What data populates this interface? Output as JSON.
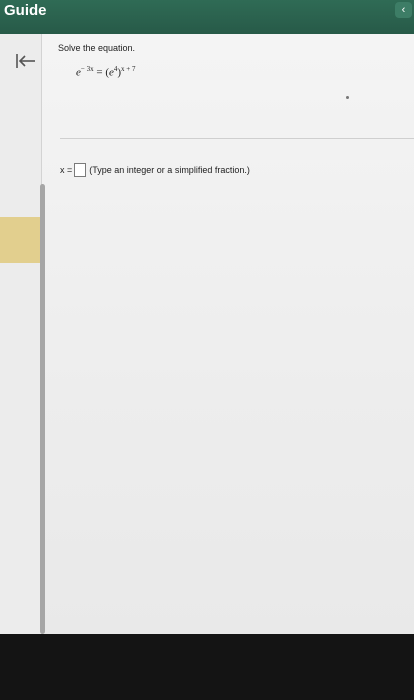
{
  "header": {
    "title": "Guide",
    "collapse_glyph": "‹",
    "collapse_icon": "chevron-left-icon",
    "background_color": "#2f6b55"
  },
  "sidebar": {
    "back_icon": "collapse-left-arrow-icon",
    "highlight_color": "#e2cf8e"
  },
  "problem": {
    "instruction": "Solve the equation.",
    "equation": {
      "lhs_base": "e",
      "lhs_exponent": "− 3x",
      "equals": "=",
      "rhs_inner_base": "e",
      "rhs_inner_exponent": "4",
      "rhs_outer_exponent": "x + 7"
    },
    "answer_variable": "x =",
    "answer_value": "",
    "answer_hint": "(Type an integer or a simplified fraction.)"
  }
}
